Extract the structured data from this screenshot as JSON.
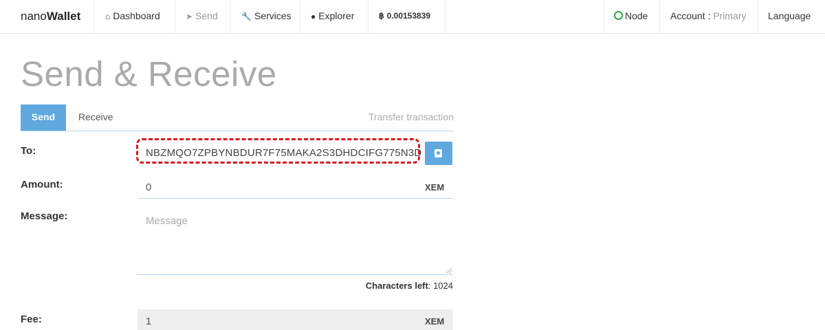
{
  "navbar": {
    "brand_prefix": "nano",
    "brand_bold": "Wallet",
    "dashboard": "Dashboard",
    "send": "Send",
    "services": "Services",
    "explorer": "Explorer",
    "balance": "0.00153839",
    "node": "Node",
    "account_label": "Account :",
    "account_name": "Primary",
    "language": "Language"
  },
  "page": {
    "title": "Send & Receive"
  },
  "tabs": {
    "send": "Send",
    "receive": "Receive",
    "hint": "Transfer transaction"
  },
  "form": {
    "to_label": "To:",
    "to_value": "NBZMQO7ZPBYNBDUR7F75MAKA2S3DHDCIFG775N3D",
    "amount_label": "Amount:",
    "amount_value": "0",
    "amount_unit": "XEM",
    "message_label": "Message:",
    "message_placeholder": "Message",
    "chars_left_label": "Characters left",
    "chars_left_value": ": 1024",
    "fee_label": "Fee:",
    "fee_value": "1",
    "fee_unit": "XEM"
  },
  "colors": {
    "accent": "#5fa9df",
    "highlight": "#d8191f",
    "node_status": "#2ea84a"
  },
  "icons": {
    "dashboard": "home-icon",
    "send": "paper-plane-icon",
    "services": "wrench-icon",
    "explorer": "globe-icon",
    "balance": "bitcoin-icon",
    "address_book": "address-book-icon"
  }
}
